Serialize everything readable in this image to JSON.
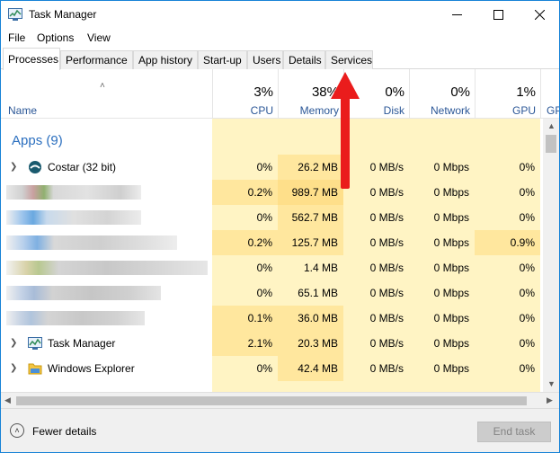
{
  "window": {
    "title": "Task Manager"
  },
  "menu": [
    "File",
    "Options",
    "View"
  ],
  "tabs": [
    "Processes",
    "Performance",
    "App history",
    "Start-up",
    "Users",
    "Details",
    "Services"
  ],
  "active_tab": "Processes",
  "columns": {
    "name": "Name",
    "cpu": {
      "pct": "3%",
      "label": "CPU"
    },
    "memory": {
      "pct": "38%",
      "label": "Memory"
    },
    "disk": {
      "pct": "0%",
      "label": "Disk"
    },
    "network": {
      "pct": "0%",
      "label": "Network"
    },
    "gpu": {
      "pct": "1%",
      "label": "GPU"
    },
    "gpu_engine": {
      "label": "GP"
    }
  },
  "group": {
    "label": "Apps (9)"
  },
  "rows": [
    {
      "name": "Costar (32 bit)",
      "cpu": "0%",
      "memory": "26.2 MB",
      "disk": "0 MB/s",
      "network": "0 Mbps",
      "gpu": "0%"
    },
    {
      "name": "",
      "cpu": "0.2%",
      "memory": "989.7 MB",
      "disk": "0 MB/s",
      "network": "0 Mbps",
      "gpu": "0%"
    },
    {
      "name": "",
      "cpu": "0%",
      "memory": "562.7 MB",
      "disk": "0 MB/s",
      "network": "0 Mbps",
      "gpu": "0%"
    },
    {
      "name": "",
      "cpu": "0.2%",
      "memory": "125.7 MB",
      "disk": "0 MB/s",
      "network": "0 Mbps",
      "gpu": "0.9%"
    },
    {
      "name": "",
      "cpu": "0%",
      "memory": "1.4 MB",
      "disk": "0 MB/s",
      "network": "0 Mbps",
      "gpu": "0%"
    },
    {
      "name": "",
      "cpu": "0%",
      "memory": "65.1 MB",
      "disk": "0 MB/s",
      "network": "0 Mbps",
      "gpu": "0%"
    },
    {
      "name": "",
      "cpu": "0.1%",
      "memory": "36.0 MB",
      "disk": "0 MB/s",
      "network": "0 Mbps",
      "gpu": "0%"
    },
    {
      "name": "Task Manager",
      "cpu": "2.1%",
      "memory": "20.3 MB",
      "disk": "0 MB/s",
      "network": "0 Mbps",
      "gpu": "0%"
    },
    {
      "name": "Windows Explorer",
      "cpu": "0%",
      "memory": "42.4 MB",
      "disk": "0 MB/s",
      "network": "0 Mbps",
      "gpu": "0%"
    }
  ],
  "footer": {
    "fewer_details": "Fewer details",
    "end_task": "End task"
  },
  "colors": {
    "accent": "#2b5797",
    "heat_light": "#fff4c4",
    "heat_medium": "#ffe79e",
    "heat_strong": "#fedf8a",
    "annotation": "#ea1c1c"
  }
}
